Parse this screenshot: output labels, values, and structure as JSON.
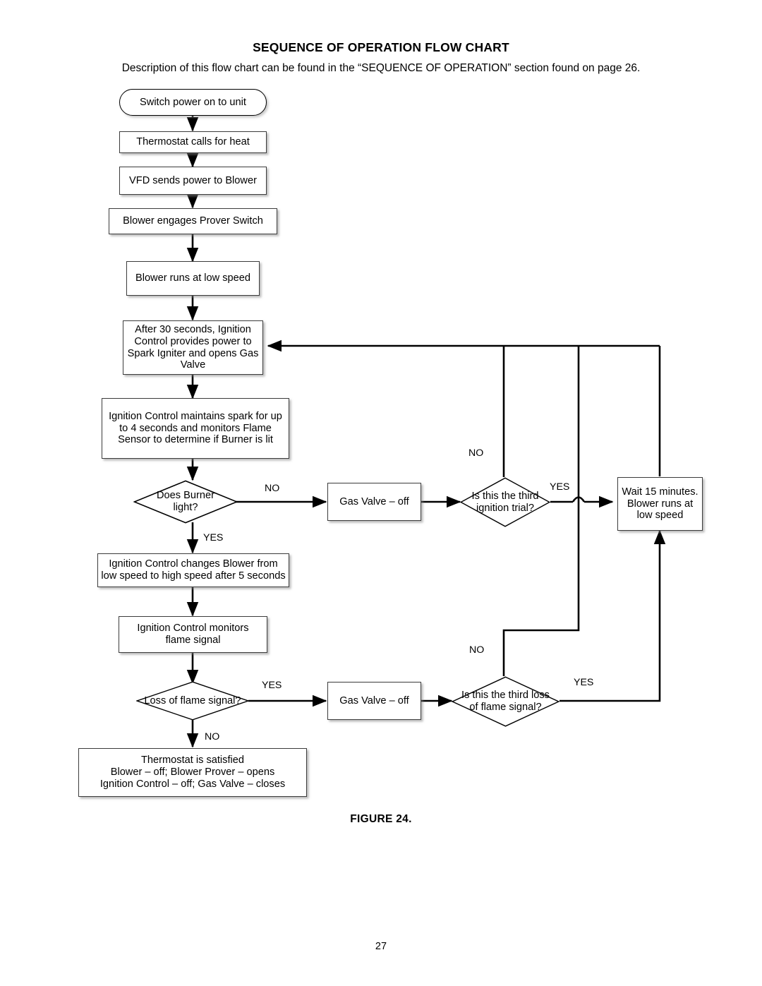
{
  "document": {
    "title": "SEQUENCE OF OPERATION FLOW CHART",
    "subtitle": "Description of this flow chart can be found in the “SEQUENCE OF OPERATION” section found on page 26.",
    "figure_caption": "FIGURE 24.",
    "page_number": "27"
  },
  "colors": {
    "background": "#ffffff",
    "text": "#000000",
    "box_border": "#3c3c3c",
    "terminator_border": "#000000",
    "connector": "#000000",
    "shadow": "#9a9a9a"
  },
  "chart_data": {
    "type": "diagram",
    "title": "SEQUENCE OF OPERATION FLOW CHART",
    "nodes": [
      {
        "id": "n1",
        "shape": "terminator",
        "text": "Switch power on to unit"
      },
      {
        "id": "n2",
        "shape": "process",
        "text": "Thermostat calls for heat"
      },
      {
        "id": "n3",
        "shape": "process",
        "text": "VFD sends power to Blower"
      },
      {
        "id": "n4",
        "shape": "process",
        "text": "Blower engages Prover Switch"
      },
      {
        "id": "n5",
        "shape": "process",
        "text": "Blower runs at low speed"
      },
      {
        "id": "n6",
        "shape": "process",
        "text": "After 30 seconds, Ignition Control provides power to Spark Igniter and opens Gas Valve"
      },
      {
        "id": "n7",
        "shape": "process",
        "text": "Ignition Control maintains spark for up to 4 seconds and monitors Flame Sensor to determine if Burner is lit"
      },
      {
        "id": "n8",
        "shape": "decision",
        "text": "Does Burner light?"
      },
      {
        "id": "n9",
        "shape": "process",
        "text": "Gas Valve – off"
      },
      {
        "id": "n10",
        "shape": "decision",
        "text": "Is this the third ignition trial?"
      },
      {
        "id": "n11",
        "shape": "process",
        "text": "Wait 15 minutes. Blower runs at low speed"
      },
      {
        "id": "n12",
        "shape": "process",
        "text": "Ignition Control changes Blower from low speed to high speed after 5 seconds"
      },
      {
        "id": "n13",
        "shape": "process",
        "text": "Ignition Control monitors flame signal"
      },
      {
        "id": "n14",
        "shape": "decision",
        "text": "Loss of flame signal?"
      },
      {
        "id": "n15",
        "shape": "process",
        "text": "Gas Valve – off"
      },
      {
        "id": "n16",
        "shape": "decision",
        "text": "Is this the third loss of flame signal?"
      },
      {
        "id": "n17",
        "shape": "process",
        "text": "Thermostat is satisfied Blower – off; Blower Prover – opens Ignition Control – off; Gas Valve – closes"
      }
    ],
    "edges": [
      {
        "from": "n1",
        "to": "n2",
        "label": ""
      },
      {
        "from": "n2",
        "to": "n3",
        "label": ""
      },
      {
        "from": "n3",
        "to": "n4",
        "label": ""
      },
      {
        "from": "n4",
        "to": "n5",
        "label": ""
      },
      {
        "from": "n5",
        "to": "n6",
        "label": ""
      },
      {
        "from": "n6",
        "to": "n7",
        "label": ""
      },
      {
        "from": "n7",
        "to": "n8",
        "label": ""
      },
      {
        "from": "n8",
        "to": "n9",
        "label": "NO"
      },
      {
        "from": "n8",
        "to": "n12",
        "label": "YES"
      },
      {
        "from": "n9",
        "to": "n10",
        "label": ""
      },
      {
        "from": "n10",
        "to": "n6",
        "label": "NO"
      },
      {
        "from": "n10",
        "to": "n11",
        "label": "YES"
      },
      {
        "from": "n11",
        "to": "n6",
        "label": ""
      },
      {
        "from": "n12",
        "to": "n13",
        "label": ""
      },
      {
        "from": "n13",
        "to": "n14",
        "label": ""
      },
      {
        "from": "n14",
        "to": "n15",
        "label": "YES"
      },
      {
        "from": "n14",
        "to": "n17",
        "label": "NO"
      },
      {
        "from": "n15",
        "to": "n16",
        "label": ""
      },
      {
        "from": "n16",
        "to": "n6",
        "label": "NO"
      },
      {
        "from": "n16",
        "to": "n11",
        "label": "YES"
      }
    ]
  },
  "nodes": {
    "n1": {
      "line1": "Switch power on to unit"
    },
    "n2": {
      "line1": "Thermostat calls for heat"
    },
    "n3": {
      "line1": "VFD sends power to Blower"
    },
    "n4": {
      "line1": "Blower engages Prover Switch"
    },
    "n5": {
      "line1": "Blower runs at low speed"
    },
    "n6": {
      "line1": "After 30 seconds, Ignition",
      "line2": "Control provides power to",
      "line3": "Spark Igniter and opens Gas",
      "line4": "Valve"
    },
    "n7": {
      "line1": "Ignition Control maintains spark for up",
      "line2": "to 4 seconds and monitors Flame",
      "line3": "Sensor to determine if Burner is lit"
    },
    "n8": {
      "line1": "Does Burner",
      "line2": "light?"
    },
    "n9": {
      "line1": "Gas Valve – off"
    },
    "n10": {
      "line1": "Is this the third",
      "line2": "ignition trial?"
    },
    "n11": {
      "line1": "Wait 15 minutes.",
      "line2": "Blower runs at",
      "line3": "low speed"
    },
    "n12": {
      "line1": "Ignition Control changes Blower from",
      "line2": "low speed to high speed after 5 seconds"
    },
    "n13": {
      "line1": "Ignition Control monitors",
      "line2": "flame signal"
    },
    "n14": {
      "line1": "Loss of flame signal?"
    },
    "n15": {
      "line1": "Gas Valve – off"
    },
    "n16": {
      "line1": "Is this the third loss",
      "line2": "of flame signal?"
    },
    "n17": {
      "line1": "Thermostat is satisfied",
      "line2": "Blower – off; Blower Prover – opens",
      "line3": "Ignition Control – off; Gas Valve – closes"
    }
  },
  "edge_labels": {
    "burner_no": "NO",
    "burner_yes": "YES",
    "trial_no": "NO",
    "trial_yes": "YES",
    "flame_yes": "YES",
    "flame_no": "NO",
    "third_loss_no": "NO",
    "third_loss_yes": "YES"
  }
}
